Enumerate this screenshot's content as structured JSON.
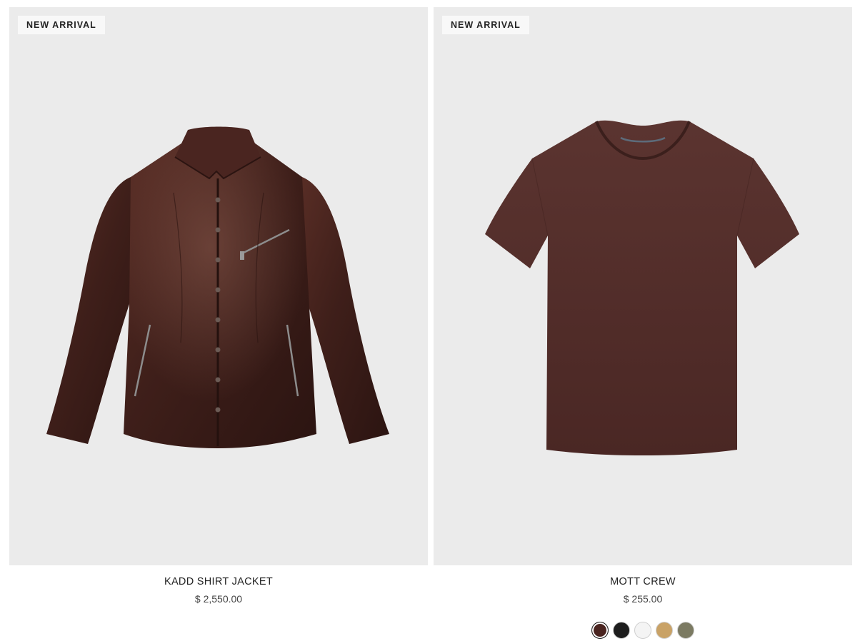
{
  "products": [
    {
      "badge": "NEW ARRIVAL",
      "name": "KADD SHIRT JACKET",
      "price": "$ 2,550.00",
      "image_icon": "leather-shirt-jacket",
      "colors": [
        "#3f1f1a"
      ]
    },
    {
      "badge": "NEW ARRIVAL",
      "name": "MOTT CREW",
      "price": "$ 255.00",
      "image_icon": "crew-tshirt",
      "colors": [
        "#4e2a26"
      ],
      "swatches": [
        {
          "name": "brown",
          "color": "#4a2420",
          "selected": true
        },
        {
          "name": "black",
          "color": "#1d1d1d",
          "selected": false
        },
        {
          "name": "white",
          "color": "#f4f4f4",
          "selected": false
        },
        {
          "name": "tan",
          "color": "#c9a266",
          "selected": false
        },
        {
          "name": "olive",
          "color": "#7b7a62",
          "selected": false
        }
      ]
    }
  ]
}
